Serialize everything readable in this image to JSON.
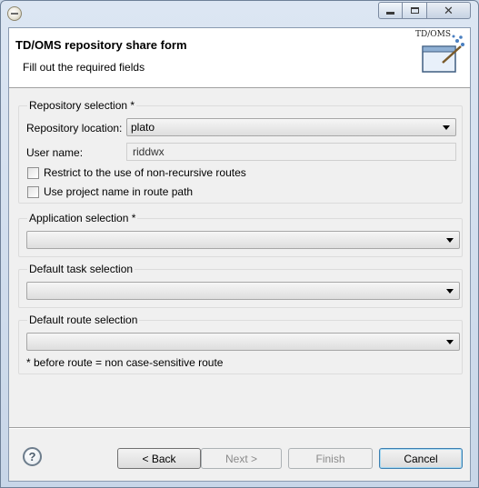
{
  "window": {
    "controls": {
      "minimize": "minimize",
      "maximize": "maximize",
      "close": "✕"
    }
  },
  "header": {
    "title": "TD/OMS repository share form",
    "subtitle": "Fill out the required fields",
    "banner_text": "TD/OMS"
  },
  "repository": {
    "group_label": "Repository selection *",
    "location_label": "Repository location:",
    "location_value": "plato",
    "username_label": "User name:",
    "username_value": "riddwx",
    "check_nonrecursive": {
      "label": "Restrict to the use of non-recursive routes",
      "checked": false
    },
    "check_projectname": {
      "label": "Use project name in route path",
      "checked": false
    }
  },
  "application": {
    "group_label": "Application selection *",
    "value": ""
  },
  "task": {
    "group_label": "Default task selection",
    "value": ""
  },
  "route": {
    "group_label": "Default route selection",
    "value": ""
  },
  "note": "* before route = non case-sensitive route",
  "footer": {
    "help_glyph": "?",
    "back_label": "< Back",
    "next_label": "Next >",
    "finish_label": "Finish",
    "cancel_label": "Cancel"
  }
}
